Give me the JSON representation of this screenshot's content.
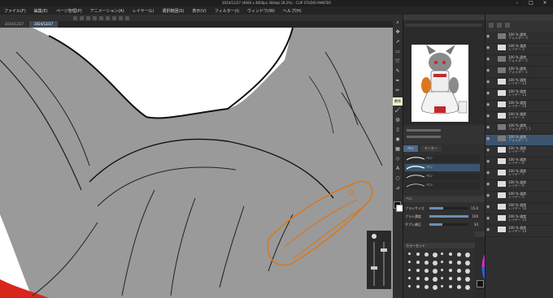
{
  "window": {
    "title": "2024/12/27 (4000 x 4600px 300dpi 28.2%) - CLIP STUDIO PAINTER"
  },
  "menu": [
    "ファイル(F)",
    "編集(E)",
    "ページ管理(P)",
    "アニメーション(A)",
    "レイヤー(L)",
    "選択範囲(S)",
    "表示(V)",
    "フィルター(I)",
    "ウィンドウ(W)",
    "ヘルプ(H)"
  ],
  "tabs": [
    "2024/12/27",
    "2024/12/27"
  ],
  "tooltip": "覆帯",
  "tool_panel": {
    "subtabs": [
      "ペン",
      "マーカー"
    ],
    "brushes": [
      "ペン",
      "ペン",
      "ペン",
      "ペン"
    ],
    "property_title": "ペン",
    "properties": [
      {
        "label": "ブラシサイズ",
        "value": "15.0",
        "fill": 0.35
      },
      {
        "label": "ブラシ濃度",
        "value": "100",
        "fill": 1.0
      },
      {
        "label": "手ブレ補正",
        "value": "34",
        "fill": 0.34
      }
    ]
  },
  "color_panel": {
    "sub_title": "カラーセット",
    "palette_title": "カラーホイール"
  },
  "layers": [
    {
      "name": "100 % 通常",
      "sub": "フォルダー 3",
      "folder": true,
      "selected": false
    },
    {
      "name": "100 % 通常",
      "sub": "レイヤー 3",
      "folder": false,
      "selected": false
    },
    {
      "name": "100 % 通常",
      "sub": "フォルダー 2",
      "folder": true,
      "selected": false
    },
    {
      "name": "100 % 通常",
      "sub": "フォルダー 1",
      "folder": true,
      "selected": false
    },
    {
      "name": "100 % 通常",
      "sub": "レイヤー 12",
      "folder": false,
      "selected": false
    },
    {
      "name": "100 % 通常",
      "sub": "レイヤー 11",
      "folder": false,
      "selected": false
    },
    {
      "name": "100 % 通常",
      "sub": "レイヤー 10",
      "folder": false,
      "selected": false
    },
    {
      "name": "100 % 通常",
      "sub": "レイヤー 2",
      "folder": false,
      "selected": false
    },
    {
      "name": "100 % 通常",
      "sub": "フォルダー 2 1",
      "folder": true,
      "selected": false
    },
    {
      "name": "100 % 通常",
      "sub": "フォルダー 1",
      "folder": true,
      "selected": true
    },
    {
      "name": "100 % 通常",
      "sub": "レイヤー 9",
      "folder": false,
      "selected": false
    },
    {
      "name": "100 % 通常",
      "sub": "レイヤー 8",
      "folder": false,
      "selected": false
    },
    {
      "name": "100 % 通常",
      "sub": "レイヤー 7",
      "folder": false,
      "selected": false
    },
    {
      "name": "100 % 通常",
      "sub": "レイヤー 6",
      "folder": false,
      "selected": false
    },
    {
      "name": "100 % 通常",
      "sub": "レイヤー 5",
      "folder": false,
      "selected": false
    },
    {
      "name": "100 % 通常",
      "sub": "レイヤー 16",
      "folder": false,
      "selected": false
    },
    {
      "name": "100 % 通常",
      "sub": "レイヤー 15",
      "folder": false,
      "selected": false
    },
    {
      "name": "100 % 通常",
      "sub": "レイヤー 14",
      "folder": false,
      "selected": false
    }
  ],
  "colors": {
    "canvas_gray": "#9a9a9a",
    "line_orange": "#d9781f",
    "selection_blue": "#3b5570"
  }
}
